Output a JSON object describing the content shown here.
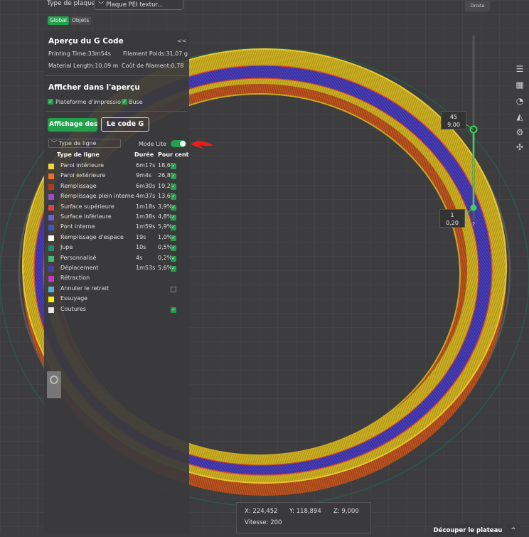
{
  "toolbar": {
    "plate_label": "Type de plaque",
    "plate_value": "Plaque PEI textur...",
    "view_label": "Droite",
    "tabs": [
      "Global",
      "Objets"
    ]
  },
  "gcode_preview": {
    "title": "Aperçu du G Code",
    "collapse_icon": "<<",
    "printing_time": "Printing Time:33m54s",
    "filament_weight": "Filament Poids:31,07 g",
    "material_length": "Material Length:10,09 m",
    "filament_cost": "Coût de filament:0,78"
  },
  "preview_display": {
    "title": "Afficher dans l'aperçu",
    "options": [
      "Plateforme d'impressio",
      "Buse"
    ]
  },
  "buttons": {
    "display": "Affichage des",
    "gcode": "Le code G"
  },
  "legend": {
    "line_type_select": "Type de ligne",
    "mode_lite_label": "Mode Lite",
    "headers": [
      "Type de ligne",
      "Durée",
      "Pour cent"
    ],
    "rows": [
      {
        "name": "Paroi intérieure",
        "time": "6m17s",
        "percent": "18,6%",
        "color": "#f3d43c",
        "checked": true
      },
      {
        "name": "Paroi extérieure",
        "time": "9m4s",
        "percent": "26,8%",
        "color": "#f06f24",
        "checked": true
      },
      {
        "name": "Remplissage",
        "time": "6m30s",
        "percent": "19,2%",
        "color": "#b13a1a",
        "checked": true
      },
      {
        "name": "Remplissage plein interne",
        "time": "4m37s",
        "percent": "13,6%",
        "color": "#9a4ec0",
        "checked": true
      },
      {
        "name": "Surface supérieure",
        "time": "1m18s",
        "percent": "3,9%",
        "color": "#e0403a",
        "checked": true
      },
      {
        "name": "Surface inférieure",
        "time": "1m38s",
        "percent": "4,8%",
        "color": "#6a5fd6",
        "checked": true
      },
      {
        "name": "Pont interne",
        "time": "1m59s",
        "percent": "5,9%",
        "color": "#3b57c9",
        "checked": true
      },
      {
        "name": "Remplissage d'espace",
        "time": "19s",
        "percent": "1,0%",
        "color": "#ffffff",
        "checked": true
      },
      {
        "name": "Jupe",
        "time": "10s",
        "percent": "0,5%",
        "color": "#1f8a7a",
        "checked": true
      },
      {
        "name": "Personnalisé",
        "time": "4s",
        "percent": "0,2%",
        "color": "#3fbd74",
        "checked": true
      },
      {
        "name": "Déplacement",
        "time": "1m53s",
        "percent": "5,6%",
        "color": "#4a3fb8",
        "checked": true
      },
      {
        "name": "Rétraction",
        "time": "",
        "percent": "",
        "color": "#c03ac9",
        "checked": null
      },
      {
        "name": "Annuler le retrait",
        "time": "",
        "percent": "",
        "color": "#4fb3d9",
        "checked": false
      },
      {
        "name": "Essuyage",
        "time": "",
        "percent": "",
        "color": "#f5f500",
        "checked": null
      },
      {
        "name": "Coutures",
        "time": "",
        "percent": "",
        "color": "#e8e8e8",
        "checked": true
      }
    ]
  },
  "layer_slider": {
    "top_layer": "45",
    "top_height": "9,00",
    "bottom_layer": "1",
    "bottom_height": "0,20",
    "help": "?"
  },
  "coordinates": {
    "x": "X: 224,452",
    "y": "Y: 118,894",
    "z": "Z: 9,000",
    "speed": "Vitesse: 200"
  },
  "footer": {
    "slice_label": "Découper le plateau",
    "caret": "^"
  },
  "sidebar_icons": [
    "layers-icon",
    "arrange-icon",
    "speedometer-icon",
    "support-icon",
    "settings-icon",
    "grid-icon"
  ]
}
